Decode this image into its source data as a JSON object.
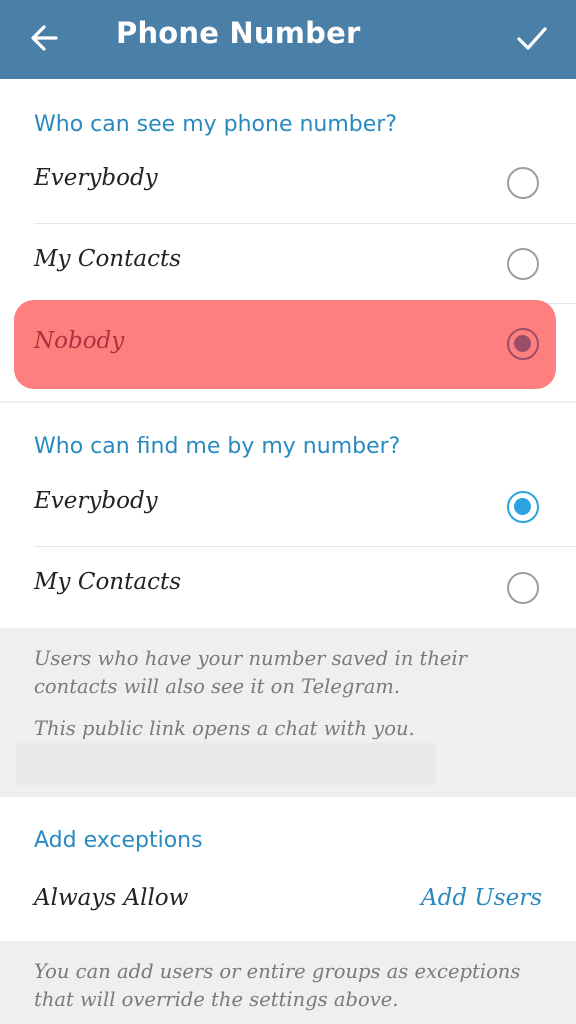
{
  "appbar": {
    "title": "Phone Number",
    "back_icon": "arrow-left-icon",
    "confirm_icon": "check-icon",
    "color": "#4a7fa8"
  },
  "who_can_see": {
    "header": "Who can see my phone number?",
    "options": [
      {
        "label": "Everybody",
        "selected": false
      },
      {
        "label": "My Contacts",
        "selected": false
      },
      {
        "label": "Nobody",
        "selected": true
      }
    ]
  },
  "who_can_find": {
    "header": "Who can find me by my number?",
    "options": [
      {
        "label": "Everybody",
        "selected": true
      },
      {
        "label": "My Contacts",
        "selected": false
      }
    ],
    "info_1": "Users who have your number saved in their contacts will also see it on Telegram.",
    "info_2": "This public link opens a chat with you."
  },
  "exceptions": {
    "header": "Add exceptions",
    "always_allow": "Always Allow",
    "add_users": "Add Users",
    "info": "You can add users or entire groups as exceptions that will override the settings above."
  },
  "colors": {
    "accent": "#2aa3e0",
    "header_text": "#2a8ac0",
    "highlight": "#ff7f7f"
  }
}
